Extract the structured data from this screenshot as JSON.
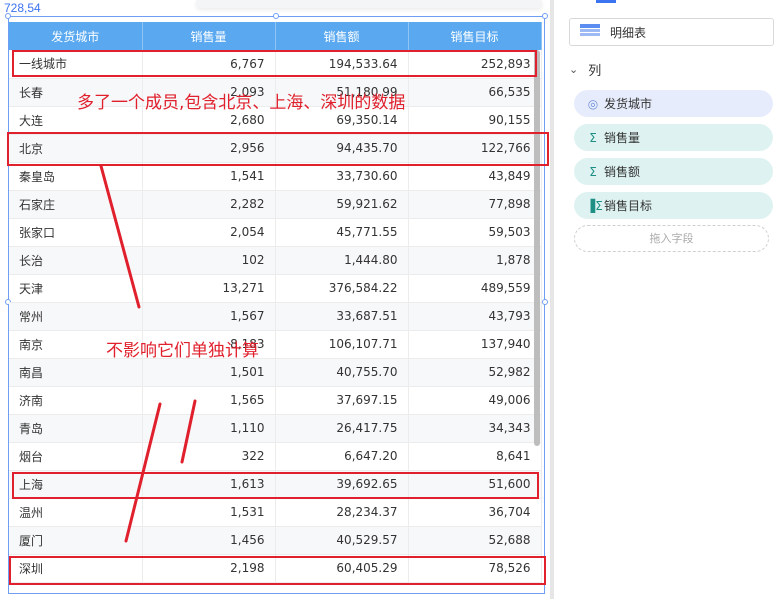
{
  "canvas": {
    "coord_readout": "728,54"
  },
  "table": {
    "columns": [
      "发货城市",
      "销售量",
      "销售额",
      "销售目标"
    ],
    "rows": [
      [
        "一线城市",
        "6,767",
        "194,533.64",
        "252,893"
      ],
      [
        "长春",
        "2,093",
        "51,180.99",
        "66,535"
      ],
      [
        "大连",
        "2,680",
        "69,350.14",
        "90,155"
      ],
      [
        "北京",
        "2,956",
        "94,435.70",
        "122,766"
      ],
      [
        "秦皇岛",
        "1,541",
        "33,730.60",
        "43,849"
      ],
      [
        "石家庄",
        "2,282",
        "59,921.62",
        "77,898"
      ],
      [
        "张家口",
        "2,054",
        "45,771.55",
        "59,503"
      ],
      [
        "长治",
        "102",
        "1,444.80",
        "1,878"
      ],
      [
        "天津",
        "13,271",
        "376,584.22",
        "489,559"
      ],
      [
        "常州",
        "1,567",
        "33,687.51",
        "43,793"
      ],
      [
        "南京",
        "8,183",
        "106,107.71",
        "137,940"
      ],
      [
        "南昌",
        "1,501",
        "40,755.70",
        "52,982"
      ],
      [
        "济南",
        "1,565",
        "37,697.15",
        "49,006"
      ],
      [
        "青岛",
        "1,110",
        "26,417.75",
        "34,343"
      ],
      [
        "烟台",
        "322",
        "6,647.20",
        "8,641"
      ],
      [
        "上海",
        "1,613",
        "39,692.65",
        "51,600"
      ],
      [
        "温州",
        "1,531",
        "28,234.37",
        "36,704"
      ],
      [
        "厦门",
        "1,456",
        "40,529.57",
        "52,688"
      ],
      [
        "深圳",
        "2,198",
        "60,405.29",
        "78,526"
      ]
    ]
  },
  "annotations": {
    "note1": "多了一个成员,包含北京、上海、深圳的数据",
    "note2": "不影响它们单独计算",
    "color": "#e0202c"
  },
  "panel": {
    "viz_type_label": "明细表",
    "viz_type_icon": "table-icon",
    "section_title": "列",
    "fields": [
      {
        "label": "发货城市",
        "kind": "dimension",
        "icon": "globe-icon"
      },
      {
        "label": "销售量",
        "kind": "measure",
        "icon": "sigma-icon"
      },
      {
        "label": "销售额",
        "kind": "measure",
        "icon": "sigma-icon"
      },
      {
        "label": "销售目标",
        "kind": "measure",
        "icon": "sigma-bar-icon"
      }
    ],
    "drop_placeholder": "拖入字段"
  },
  "colors": {
    "header_bg": "#5aa9f0",
    "accent": "#3b73f0",
    "highlight": "#e0202c"
  }
}
